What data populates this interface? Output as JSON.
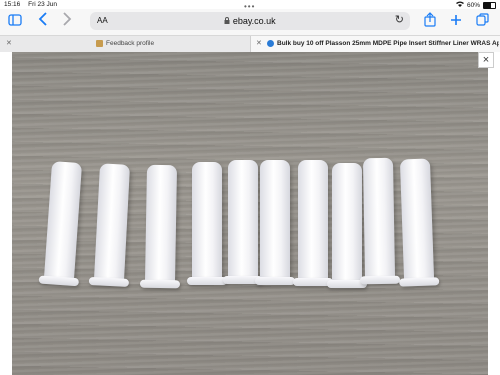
{
  "status_bar": {
    "time": "15:16",
    "date": "Fri 23 Jun",
    "battery": "60%",
    "battery_level": 0.6
  },
  "toolbar": {
    "text_size_label": "AA",
    "url": "ebay.co.uk",
    "icons": [
      "sidebar-icon",
      "back-icon",
      "forward-icon",
      "lock-icon",
      "reload-icon",
      "share-icon",
      "plus-icon",
      "tabs-icon"
    ]
  },
  "tabs": [
    {
      "label": "Feedback profile"
    },
    {
      "label": "Bulk buy 10 off Plasson 25mm MDPE Pipe Insert Stiffner Liner WRAS Appr..."
    }
  ],
  "viewer": {
    "close_label": "×"
  }
}
